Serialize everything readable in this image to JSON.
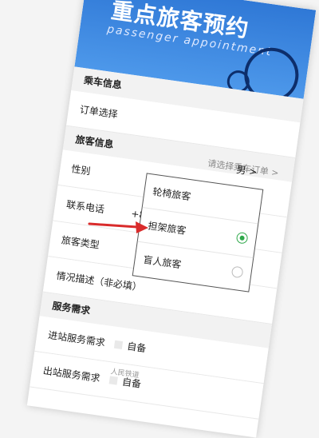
{
  "banner": {
    "title": "重点旅客预约",
    "subtitle": "passenger appointment"
  },
  "sections": {
    "train_info": "乘车信息",
    "passenger_info": "旅客信息",
    "service_needs": "服务需求"
  },
  "rows": {
    "order_select": "订单选择",
    "order_hint": "请选择乘车订单 >",
    "gender": "性别",
    "gender_value": "男 >",
    "phone": "联系电话",
    "phone_code": "+86 ⌄",
    "passenger_type": "旅客类型",
    "description": "情况描述（非必填）",
    "in_station": "进站服务需求",
    "out_station": "出站服务需求",
    "self_prepare": "自备"
  },
  "popup": {
    "options": [
      "轮椅旅客",
      "担架旅客",
      "盲人旅客"
    ],
    "selected_index": 0
  },
  "watermark": "人民铁道",
  "colors": {
    "banner": "#3a86df",
    "selected": "#2ea84a",
    "arrow": "#d92b2b"
  }
}
